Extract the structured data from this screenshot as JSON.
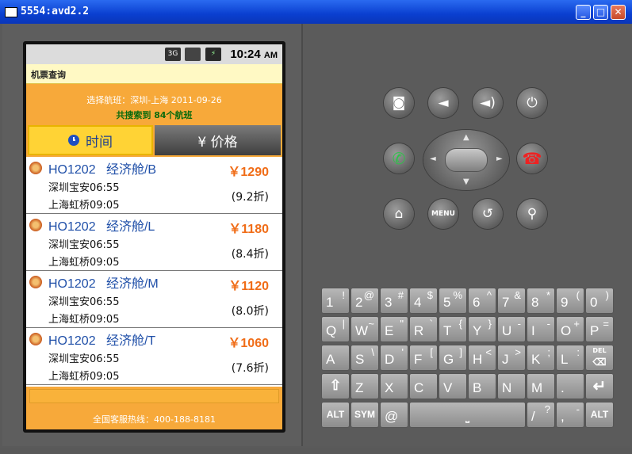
{
  "window": {
    "title": "5554:avd2.2",
    "controls": [
      "minimize",
      "maximize",
      "close"
    ]
  },
  "status_bar": {
    "network": "3G",
    "time": "10:24",
    "ampm": "AM"
  },
  "app": {
    "title": "机票查询",
    "route_line": "选择航班：深圳-上海 2011-09-26",
    "result_line": "共搜索到 84个航班",
    "tabs": [
      {
        "label": "时间",
        "icon": "clock-icon"
      },
      {
        "label": "¥ 价格"
      }
    ],
    "flights": [
      {
        "code": "HO1202",
        "cabin": "经济舱/B",
        "price": "￥1290",
        "depart": "深圳宝安06:55",
        "arrive": "上海虹桥09:05",
        "discount": "(9.2折)"
      },
      {
        "code": "HO1202",
        "cabin": "经济舱/L",
        "price": "￥1180",
        "depart": "深圳宝安06:55",
        "arrive": "上海虹桥09:05",
        "discount": "(8.4折)"
      },
      {
        "code": "HO1202",
        "cabin": "经济舱/M",
        "price": "￥1120",
        "depart": "深圳宝安06:55",
        "arrive": "上海虹桥09:05",
        "discount": "(8.0折)"
      },
      {
        "code": "HO1202",
        "cabin": "经济舱/T",
        "price": "￥1060",
        "depart": "深圳宝安06:55",
        "arrive": "上海虹桥09:05",
        "discount": "(7.6折)"
      }
    ],
    "hotline": "全国客服热线：400-188-8181"
  },
  "controls": {
    "menu_label": "MENU"
  },
  "keyboard": {
    "row1": [
      [
        "1",
        "!"
      ],
      [
        "2",
        "@"
      ],
      [
        "3",
        "#"
      ],
      [
        "4",
        "$"
      ],
      [
        "5",
        "%"
      ],
      [
        "6",
        "^"
      ],
      [
        "7",
        "&"
      ],
      [
        "8",
        "*"
      ],
      [
        "9",
        "("
      ],
      [
        "0",
        ")"
      ]
    ],
    "row2": [
      [
        "Q",
        "|"
      ],
      [
        "W",
        "~"
      ],
      [
        "E",
        "\""
      ],
      [
        "R",
        "`"
      ],
      [
        "T",
        "{"
      ],
      [
        "Y",
        "}"
      ],
      [
        "U",
        "-"
      ],
      [
        "I",
        "-"
      ],
      [
        "O",
        "+"
      ],
      [
        "P",
        "="
      ]
    ],
    "row3": [
      [
        "A",
        ""
      ],
      [
        "S",
        "\\"
      ],
      [
        "D",
        "'"
      ],
      [
        "F",
        "["
      ],
      [
        "G",
        "]"
      ],
      [
        "H",
        "<"
      ],
      [
        "J",
        ">"
      ],
      [
        "K",
        ";"
      ],
      [
        "L",
        ":"
      ]
    ],
    "row4": [
      [
        "Z",
        ""
      ],
      [
        "X",
        ""
      ],
      [
        "C",
        ""
      ],
      [
        "V",
        ""
      ],
      [
        "B",
        ""
      ],
      [
        "N",
        ""
      ],
      [
        "M",
        ""
      ],
      [
        ".",
        ""
      ]
    ],
    "row5": {
      "alt": "ALT",
      "sym": "SYM",
      "at": "@",
      "slash": "/",
      "slash_shift": "?",
      "comma": ",",
      "comma_shift": "-",
      "alt2": "ALT"
    },
    "del": "DEL"
  }
}
